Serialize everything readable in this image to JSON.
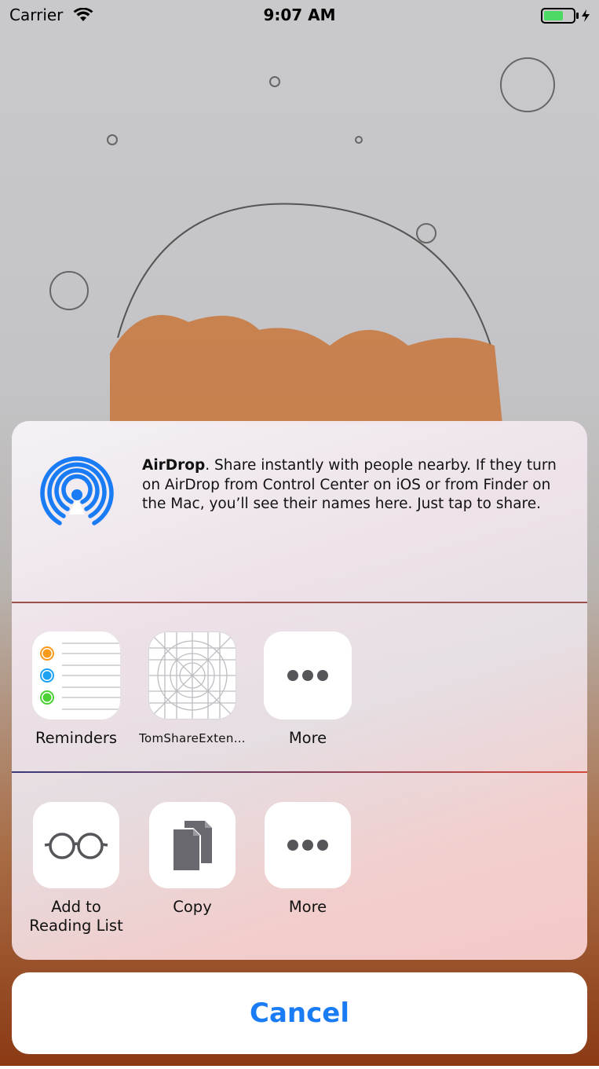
{
  "status_bar": {
    "carrier": "Carrier",
    "time": "9:07 AM"
  },
  "airdrop": {
    "title": "AirDrop",
    "description": ". Share instantly with people nearby. If they turn on AirDrop from Control Center on iOS or from Finder on the Mac, you’ll see their names here. Just tap to share.",
    "icon": "airdrop-icon",
    "accent": "#1a7cf5"
  },
  "share_row": {
    "items": [
      {
        "label": "Reminders",
        "icon": "reminders-icon"
      },
      {
        "label": "TomShareExten…",
        "icon": "app-template-icon"
      },
      {
        "label": "More",
        "icon": "ellipsis-icon"
      }
    ]
  },
  "action_row": {
    "items": [
      {
        "label_line1": "Add to",
        "label_line2": "Reading List",
        "icon": "glasses-icon"
      },
      {
        "label": "Copy",
        "icon": "copy-icon"
      },
      {
        "label": "More",
        "icon": "ellipsis-icon"
      }
    ]
  },
  "cancel": {
    "label": "Cancel",
    "color": "#1a7cf5"
  }
}
